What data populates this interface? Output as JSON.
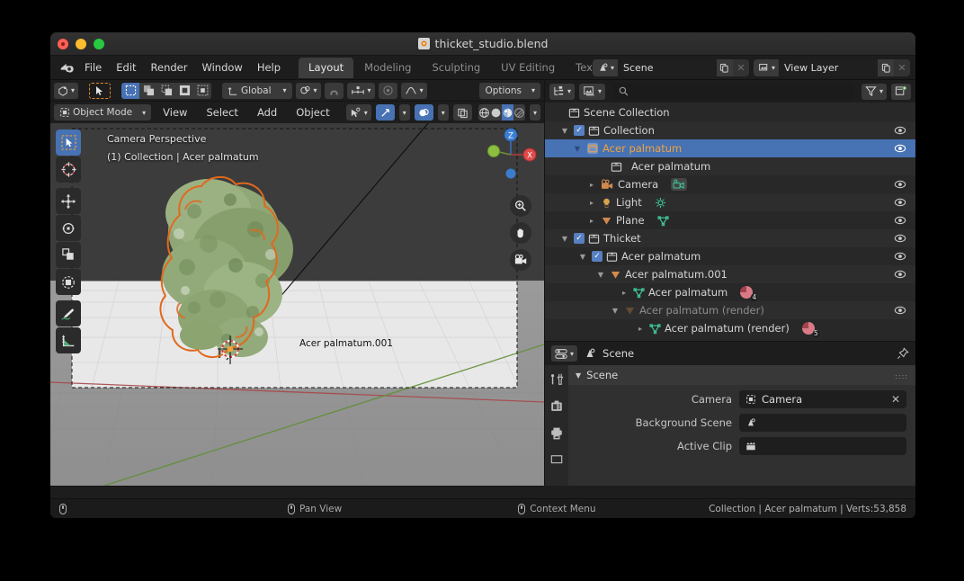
{
  "window": {
    "title": "thicket_studio.blend",
    "file_icon": "blend-file-icon"
  },
  "topbar": {
    "logo": "blender-logo-icon",
    "menus": [
      "File",
      "Edit",
      "Render",
      "Window",
      "Help"
    ],
    "tabs": [
      {
        "label": "Layout",
        "active": true
      },
      {
        "label": "Modeling",
        "active": false
      },
      {
        "label": "Sculpting",
        "active": false
      },
      {
        "label": "UV Editing",
        "active": false
      },
      {
        "label": "Texture",
        "active": false
      }
    ],
    "scene": {
      "picker_icon": "scene-data-icon",
      "value": "Scene",
      "new_btn": "new-scene-icon",
      "unlink_btn": "unlink-icon"
    },
    "view_layer": {
      "picker_icon": "view-layer-icon",
      "value": "View Layer",
      "new_btn": "new-view-layer-icon",
      "unlink_btn": "unlink-icon"
    }
  },
  "viewport_header": {
    "editor_type": "editor-type-3d-viewport",
    "select_tool": "select-box-tool",
    "select_modes": [
      "set-new-selection",
      "extend-selection",
      "subtract-selection",
      "invert-selection",
      "intersect-selection"
    ],
    "transform_orientation": {
      "icon": "orientation-icon",
      "value": "Global"
    },
    "pivot_point": "pivot-point-icon",
    "snap_magnet": "snap-magnet-icon",
    "snap_to": "snap-to-increment-icon",
    "proportional_edit": "proportional-editing-icon",
    "falloff": "proportional-falloff-icon",
    "options": "Options"
  },
  "viewport_header2": {
    "mode": {
      "icon": "object-mode-icon",
      "value": "Object Mode"
    },
    "menus": [
      "View",
      "Select",
      "Add",
      "Object"
    ],
    "visibility": "object-visibility-icon",
    "gizmos": "gizmo-icon",
    "overlays": "overlays-icon",
    "xray": "toggle-xray-icon",
    "shading_modes": [
      "wireframe-shading",
      "solid-shading",
      "material-preview-shading",
      "rendered-shading"
    ],
    "shading_active_index": 2
  },
  "viewport": {
    "overlay_line1": "Camera Perspective",
    "overlay_line2": "(1) Collection | Acer palmatum",
    "object_label": "Acer palmatum.001",
    "tools": [
      {
        "name": "tweak-select-box-tool",
        "active": true
      },
      {
        "name": "cursor-tool",
        "active": false
      },
      {
        "name": "move-tool",
        "active": false
      },
      {
        "name": "rotate-tool",
        "active": false
      },
      {
        "name": "scale-tool",
        "active": false
      },
      {
        "name": "transform-tool",
        "active": false
      },
      {
        "name": "annotate-tool",
        "active": false
      },
      {
        "name": "measure-tool",
        "active": false
      }
    ],
    "gizmo": {
      "axis_x": "X",
      "axis_y": "Y",
      "axis_z": "Z",
      "color_x": "#e04a4a",
      "color_y": "#8cbf3f",
      "color_z": "#3b7fd4"
    },
    "nav_buttons": [
      "zoom-icon",
      "pan-hand-icon",
      "camera-view-icon"
    ],
    "colors": {
      "sky": "#3c3c3c",
      "ground": "#969696",
      "plane": "#e9e9e9",
      "axis_x_line": "#a33a3a",
      "axis_y_line": "#5c8a2e",
      "selection_outline": "#e06a1f",
      "foliage": "#86a068"
    }
  },
  "viewport_footer": {
    "status_icon": "mouse-icon"
  },
  "outliner": {
    "header": {
      "display_mode": "outliner-display-mode-icon",
      "filter_id": "id-type-filter-icon",
      "search_icon": "search-icon",
      "search_value": "",
      "search_placeholder": "",
      "filter": "filter-funnel-icon",
      "new_collection": "new-collection-icon"
    },
    "rows": [
      {
        "indent": 0,
        "tri": "",
        "check": false,
        "icon": "collection-icon",
        "label": "Scene Collection",
        "eye": false,
        "selected": false,
        "dim": false,
        "material": null
      },
      {
        "indent": 1,
        "tri": "down",
        "check": true,
        "icon": "collection-icon",
        "label": "Collection",
        "eye": true,
        "selected": false,
        "dim": false,
        "material": null
      },
      {
        "indent": 2,
        "tri": "down",
        "check": false,
        "icon": "collection-instance-icon",
        "label": "Acer palmatum",
        "eye": true,
        "selected": true,
        "dim": false,
        "material": null
      },
      {
        "indent": 3,
        "tri": "",
        "check": false,
        "icon": "collection-icon",
        "label": "Acer palmatum",
        "eye": false,
        "selected": false,
        "dim": false,
        "material": null
      },
      {
        "indent": 2,
        "tri": "right",
        "check": false,
        "icon": "camera-icon",
        "label": "Camera",
        "eye": true,
        "selected": false,
        "dim": false,
        "material": null,
        "data_icon": "camera-data-icon"
      },
      {
        "indent": 2,
        "tri": "right",
        "check": false,
        "icon": "light-icon",
        "label": "Light",
        "eye": true,
        "selected": false,
        "dim": false,
        "material": null,
        "data_icon": "light-data-icon"
      },
      {
        "indent": 2,
        "tri": "right",
        "check": false,
        "icon": "mesh-object-icon",
        "label": "Plane",
        "eye": true,
        "selected": false,
        "dim": false,
        "material": null,
        "data_icon": "mesh-data-icon"
      },
      {
        "indent": 1,
        "tri": "down",
        "check": true,
        "icon": "collection-icon",
        "label": "Thicket",
        "eye": true,
        "selected": false,
        "dim": false,
        "material": null
      },
      {
        "indent": 2,
        "tri": "down",
        "check": true,
        "icon": "collection-icon",
        "label": "Acer palmatum",
        "eye": true,
        "selected": false,
        "dim": false,
        "material": null
      },
      {
        "indent": 3,
        "tri": "down",
        "check": false,
        "icon": "mesh-object-icon",
        "label": "Acer palmatum.001",
        "eye": true,
        "selected": false,
        "dim": false,
        "material": null
      },
      {
        "indent": 4,
        "tri": "right",
        "check": false,
        "icon": "mesh-data-icon",
        "label": "Acer palmatum",
        "eye": false,
        "selected": false,
        "dim": false,
        "material": "4"
      },
      {
        "indent": 4,
        "tri": "down",
        "check": false,
        "icon": "mesh-object-icon-dim",
        "label": "Acer palmatum (render)",
        "eye": true,
        "selected": false,
        "dim": true,
        "material": null
      },
      {
        "indent": 5,
        "tri": "right",
        "check": false,
        "icon": "mesh-data-icon",
        "label": "Acer palmatum (render)",
        "eye": false,
        "selected": false,
        "dim": false,
        "material": "5"
      }
    ]
  },
  "properties": {
    "editor_type": "editor-type-properties",
    "breadcrumb_icon": "scene-properties-icon",
    "breadcrumb": "Scene",
    "pin_icon": "pin-icon",
    "tabs": [
      "tool-properties-tab",
      "render-properties-tab",
      "output-properties-tab",
      "view-layer-properties-tab"
    ],
    "panel_title": "Scene",
    "rows": [
      {
        "label": "Camera",
        "icon": "camera-object-icon",
        "value": "Camera",
        "clearable": true
      },
      {
        "label": "Background Scene",
        "icon": "scene-data-icon",
        "value": "",
        "clearable": false
      },
      {
        "label": "Active Clip",
        "icon": "movie-clip-icon",
        "value": "",
        "clearable": false
      }
    ]
  },
  "statusbar": {
    "left_icon": "mouse-icon",
    "items": [
      {
        "icon": "mouse-icon",
        "label": "Pan View"
      },
      {
        "icon": "mouse-icon",
        "label": "Context Menu"
      }
    ],
    "right": "Collection | Acer palmatum | Verts:53,858"
  }
}
